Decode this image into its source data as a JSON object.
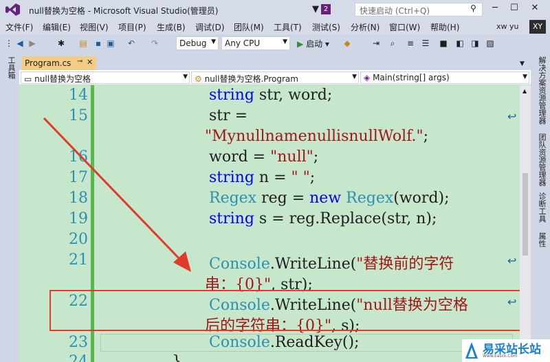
{
  "window": {
    "title": "null替换为空格 - Microsoft Visual Studio(管理员)",
    "notification_count": "2",
    "quick_launch_placeholder": "快速启动 (Ctrl+Q)"
  },
  "menu": [
    "文件(F)",
    "编辑(E)",
    "视图(V)",
    "项目(P)",
    "生成(B)",
    "调试(D)",
    "团队(M)",
    "工具(T)",
    "测试(S)",
    "分析(N)",
    "窗口(W)",
    "帮助(H)"
  ],
  "user": {
    "name": "xw yu",
    "initials": "XY"
  },
  "toolbar": {
    "config": "Debug",
    "platform": "Any CPU",
    "start_label": "启动"
  },
  "left_panel": {
    "label": "工具箱"
  },
  "right_panel": [
    "解决方案资源管理器",
    "团队资源管理器",
    "诊断工具",
    "属性"
  ],
  "tab": {
    "label": "Program.cs"
  },
  "nav": {
    "project": "null替换为空格",
    "class": "null替换为空格.Program",
    "member": "Main(string[] args)"
  },
  "code": {
    "lines": [
      {
        "num": "14"
      },
      {
        "num": "15"
      },
      {
        "num": "16"
      },
      {
        "num": "17"
      },
      {
        "num": "18"
      },
      {
        "num": "19"
      },
      {
        "num": "20"
      },
      {
        "num": "21"
      },
      {
        "num": "22"
      },
      {
        "num": "23"
      },
      {
        "num": "24"
      }
    ],
    "l14_kw": "string",
    "l14_rest": " str, word;",
    "l15a": "str =",
    "l15b": "\"MynullnamenullisnullWolf.\"",
    "l15c": ";",
    "l16a": "word = ",
    "l16b": "\"null\"",
    "l16c": ";",
    "l17_kw": "string",
    "l17a": " n = ",
    "l17b": "\" \"",
    "l17c": ";",
    "l18_ty": "Regex",
    "l18a": " reg = ",
    "l18_kw": "new",
    "l18b": " ",
    "l18_ty2": "Regex",
    "l18c": "(word);",
    "l19_kw": "string",
    "l19a": " s = reg.Replace(str, n);",
    "l21_ty": "Console",
    "l21a": ".WriteLine(",
    "l21b": "\"替换前的字符",
    "l21c": "串：{0}\"",
    "l21d": ", str);",
    "l22_ty": "Console",
    "l22a": ".WriteLine(",
    "l22b": "\"null替换为空格",
    "l22c": "后的字符串：{0}\"",
    "l22d": ", s);",
    "l23_ty": "Console",
    "l23a": ".ReadKey();",
    "l24a": "}"
  },
  "watermark": {
    "text": "易采站长站",
    "sub": "Www.Easck.Com"
  },
  "colors": {
    "editor_bg": "#c6e7cc",
    "change_bar": "#57b84e",
    "highlight_box": "#e23a2a",
    "tab_active": "#f5cc84",
    "accent": "#68217a"
  }
}
